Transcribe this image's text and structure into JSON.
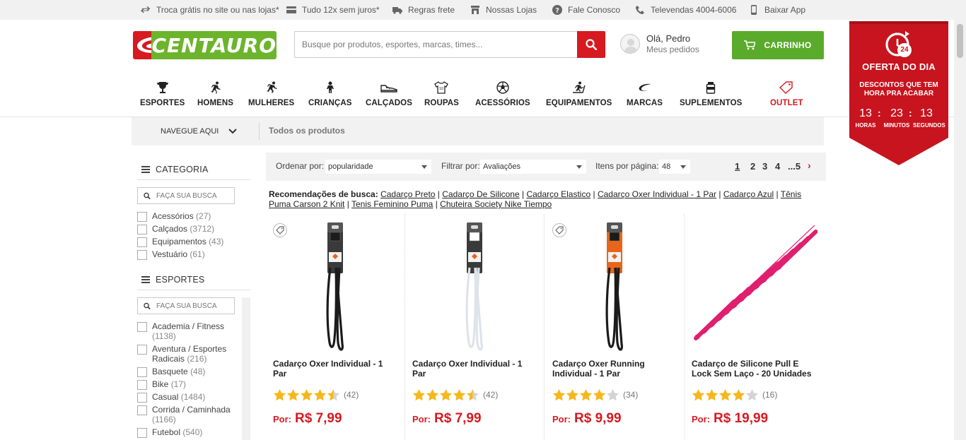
{
  "topbar": {
    "items": [
      {
        "icon": "swap-arrows-icon",
        "label": "Troca grátis no site ou nas lojas*"
      },
      {
        "icon": "credit-card-icon",
        "label": "Tudo 12x sem juros*"
      },
      {
        "icon": "truck-icon",
        "label": "Regras frete"
      },
      {
        "icon": "store-icon",
        "label": "Nossas Lojas"
      },
      {
        "icon": "question-icon",
        "label": "Fale Conosco"
      },
      {
        "icon": "phone-icon",
        "label": "Televendas 4004-6006"
      },
      {
        "icon": "mobile-icon",
        "label": "Baixar App"
      }
    ]
  },
  "header": {
    "logo_text": "CENTAURO",
    "search_placeholder": "Busque por produtos, esportes, marcas, times...",
    "user_greeting": "Olá, Pedro",
    "user_orders": "Meus pedidos",
    "cart_label": "CARRINHO"
  },
  "nav": {
    "items": [
      {
        "icon": "trophy-icon",
        "label": "ESPORTES"
      },
      {
        "icon": "man-running-icon",
        "label": "HOMENS"
      },
      {
        "icon": "woman-running-icon",
        "label": "MULHERES"
      },
      {
        "icon": "child-icon",
        "label": "CRIANÇAS"
      },
      {
        "icon": "shoe-icon",
        "label": "CALÇADOS"
      },
      {
        "icon": "shirt-icon",
        "label": "ROUPAS"
      },
      {
        "icon": "ball-icon",
        "label": "ACESSÓRIOS"
      },
      {
        "icon": "treadmill-icon",
        "label": "EQUIPAMENTOS"
      },
      {
        "icon": "brand-swoosh-icon",
        "label": "MARCAS"
      },
      {
        "icon": "supplement-icon",
        "label": "SUPLEMENTOS"
      },
      {
        "icon": "tag-icon",
        "label": "OUTLET"
      }
    ]
  },
  "oferta": {
    "title": "OFERTA DO DIA",
    "subtitle_line1": "DESCONTOS QUE TEM",
    "subtitle_line2": "HORA PRA ACABAR",
    "badge": "24",
    "hours": "13",
    "minutes": "23",
    "seconds": "13",
    "hours_label": "HORAS",
    "minutes_label": "MINUTOS",
    "seconds_label": "SEGUNDOS"
  },
  "breadcrumb": {
    "navegue": "NAVEGUE AQUI",
    "current": "Todos os produtos"
  },
  "sidebar": {
    "categoria_title": "CATEGORIA",
    "categoria_search_placeholder": "FAÇA SUA BUSCA",
    "categorias": [
      {
        "label": "Acessórios",
        "count": "(27)"
      },
      {
        "label": "Calçados",
        "count": "(3712)"
      },
      {
        "label": "Equipamentos",
        "count": "(43)"
      },
      {
        "label": "Vestuário",
        "count": "(61)"
      }
    ],
    "esportes_title": "ESPORTES",
    "esportes_search_placeholder": "FAÇA SUA BUSCA",
    "esportes": [
      {
        "label": "Academia / Fitness",
        "count": "(1138)"
      },
      {
        "label": "Aventura / Esportes Radicais",
        "count": "(216)"
      },
      {
        "label": "Basquete",
        "count": "(48)"
      },
      {
        "label": "Bike",
        "count": "(17)"
      },
      {
        "label": "Casual",
        "count": "(1484)"
      },
      {
        "label": "Corrida / Caminhada",
        "count": "(1166)"
      },
      {
        "label": "Futebol",
        "count": "(540)"
      }
    ]
  },
  "toolbar": {
    "sort_label": "Ordenar por:",
    "sort_value": "popularidade",
    "filter_label": "Filtrar por:",
    "filter_value": "Avaliações",
    "perpage_label": "Itens por página:",
    "perpage_value": "48",
    "pages": [
      "1",
      "2",
      "3",
      "4",
      "...5"
    ],
    "next": "›"
  },
  "recommendations": {
    "label": "Recomendações de busca:",
    "links": [
      "Cadarço Preto",
      "Cadarço De Silicone",
      "Cadarço Elastico",
      "Cadarço Oxer Individual - 1 Par",
      "Cadarço Azul",
      "Tênis Puma Carson 2 Knit",
      "Tenis Feminino Puma",
      "Chuteira Society Nike Tiempo"
    ]
  },
  "products": [
    {
      "name": "Cadarço Oxer Individual - 1 Par",
      "rating": 4.5,
      "reviews": "(42)",
      "price_prefix": "Por:",
      "price": "R$ 7,99",
      "has_tag": true,
      "lace_color": "#1b1b1b",
      "card_color": "#3a3a3a"
    },
    {
      "name": "Cadarço Oxer Individual - 1 Par",
      "rating": 4.5,
      "reviews": "(42)",
      "price_prefix": "Por:",
      "price": "R$ 7,99",
      "has_tag": false,
      "lace_color": "#ffffff",
      "card_color": "#3a3a3a"
    },
    {
      "name": "Cadarço Oxer Running Individual - 1 Par",
      "rating": 4,
      "reviews": "(34)",
      "price_prefix": "Por:",
      "price": "R$ 9,99",
      "has_tag": true,
      "lace_color": "#1b1b1b",
      "card_color": "#e8661c"
    },
    {
      "name": "Cadarço de Silicone Pull E Lock Sem Laço - 20 Unidades",
      "rating": 4,
      "reviews": "(16)",
      "price_prefix": "Por:",
      "price": "R$ 19,99",
      "has_tag": false,
      "lace_color": "#e01f6e",
      "card_color": "#e01f6e"
    }
  ],
  "colors": {
    "brand_red": "#d71920",
    "brand_green": "#6cb42c",
    "cart_green": "#5aab2b",
    "star_yellow": "#f6b71a"
  }
}
